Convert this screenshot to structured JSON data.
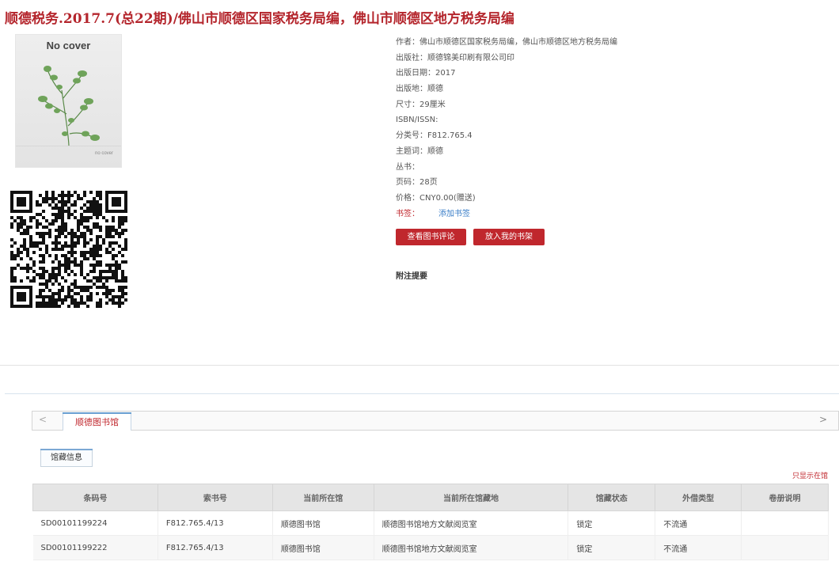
{
  "book": {
    "title": "顺德税务.2017.7(总22期)/佛山市顺德区国家税务局编，佛山市顺德区地方税务局编",
    "cover": {
      "top_text": "No cover",
      "bottom_text": "no cover"
    }
  },
  "details": [
    "作者：佛山市顺德区国家税务局编，佛山市顺德区地方税务局编",
    "出版社：顺德锦美印刷有限公司印",
    "出版日期：2017",
    "出版地：顺德",
    "尺寸：29厘米",
    "ISBN/ISSN:",
    "分类号：F812.765.4",
    "主题词：顺德",
    "丛书：",
    "页码：28页",
    "价格：CNY0.00(赠送)"
  ],
  "bookmark": {
    "label": "书签：",
    "add_label": "添加书签"
  },
  "buttons": {
    "review": "查看图书评论",
    "shelf": "放入我的书架"
  },
  "notes_heading": "附注提要",
  "holdings": {
    "library_tab": "顺德图书馆",
    "arrow_left": "<",
    "arrow_right": ">",
    "sub_tab": "馆藏信息",
    "local_only": "只显示在馆",
    "columns": [
      "条码号",
      "索书号",
      "当前所在馆",
      "当前所在馆藏地",
      "馆藏状态",
      "外借类型",
      "卷册说明"
    ],
    "rows": [
      [
        "SD00101199224",
        "F812.765.4/13",
        "顺德图书馆",
        "顺德图书馆地方文献阅览室",
        "锁定",
        "不流通",
        ""
      ],
      [
        "SD00101199222",
        "F812.765.4/13",
        "顺德图书馆",
        "顺德图书馆地方文献阅览室",
        "锁定",
        "不流通",
        ""
      ]
    ]
  },
  "colors": {
    "accent_red": "#c0272d",
    "title_red": "#b4252c",
    "link_blue": "#3a7ec8"
  },
  "icons": {
    "qr": "qr-code-icon",
    "cover_art": "plant-illustration"
  }
}
